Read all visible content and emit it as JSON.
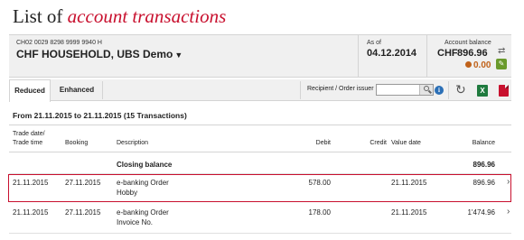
{
  "page": {
    "title_plain": "List of ",
    "title_accent": "account transactions"
  },
  "account": {
    "number": "CH02 0029 8298 9999 9940 H",
    "name": "CHF HOUSEHOLD, UBS Demo",
    "asof_label": "As of",
    "asof_date": "04.12.2014",
    "balance_label": "Account balance",
    "currency": "CHF",
    "balance": "896.96",
    "pending": "0.00",
    "pending_color": "#c0621a"
  },
  "toolbar": {
    "tabs": [
      {
        "label": "Reduced",
        "active": true
      },
      {
        "label": "Enhanced",
        "active": false
      }
    ],
    "recipient_label": "Recipient / Order issuer",
    "recipient_value": "",
    "icons": [
      "search-icon",
      "info-icon",
      "refresh-icon",
      "excel-icon",
      "pdf-icon"
    ]
  },
  "period": "From 21.11.2015 to 21.11.2015 (15 Transactions)",
  "table": {
    "headers": {
      "trade_date": "Trade date/",
      "trade_time": "Trade time",
      "booking": "Booking",
      "description": "Description",
      "debit": "Debit",
      "credit": "Credit",
      "value_date": "Value date",
      "balance": "Balance"
    },
    "closing_label": "Closing balance",
    "closing_balance": "896.96",
    "rows": [
      {
        "trade_date": "21.11.2015",
        "booking": "27.11.2015",
        "description": "e-banking Order",
        "detail": "Hobby",
        "debit": "578.00",
        "credit": "",
        "value_date": "21.11.2015",
        "balance": "896.96",
        "selected": true
      },
      {
        "trade_date": "21.11.2015",
        "booking": "27.11.2015",
        "description": "e-banking Order",
        "detail": "Invoice No.",
        "debit": "178.00",
        "credit": "",
        "value_date": "21.11.2015",
        "balance": "1'474.96",
        "selected": false
      }
    ]
  },
  "colors": {
    "accent": "#c8102e",
    "bar_bg": "#f0f0f0"
  }
}
